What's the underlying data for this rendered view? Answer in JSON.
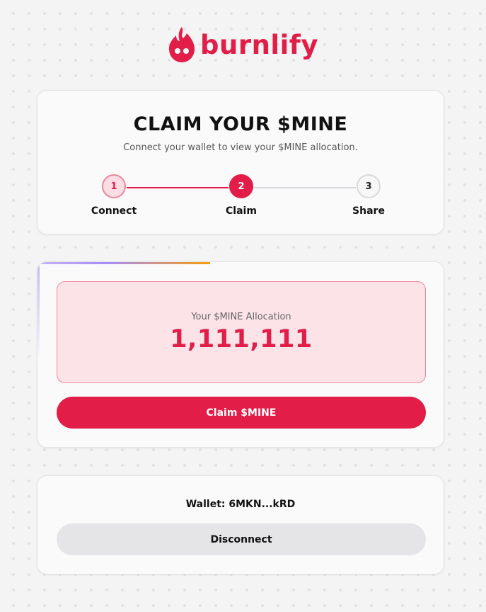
{
  "brand": {
    "name": "burnlify",
    "logo_icon": "flame-icon",
    "accent": "#e11d48"
  },
  "header": {
    "title": "CLAIM YOUR $MINE",
    "subtitle": "Connect your wallet to view your $MINE allocation."
  },
  "steps": [
    {
      "number": "1",
      "label": "Connect",
      "state": "completed"
    },
    {
      "number": "2",
      "label": "Claim",
      "state": "active"
    },
    {
      "number": "3",
      "label": "Share",
      "state": "pending"
    }
  ],
  "allocation": {
    "label": "Your $MINE Allocation",
    "value": "1,111,111"
  },
  "actions": {
    "claim_label": "Claim $MINE",
    "disconnect_label": "Disconnect"
  },
  "wallet": {
    "text": "Wallet: 6MKN...kRD"
  }
}
